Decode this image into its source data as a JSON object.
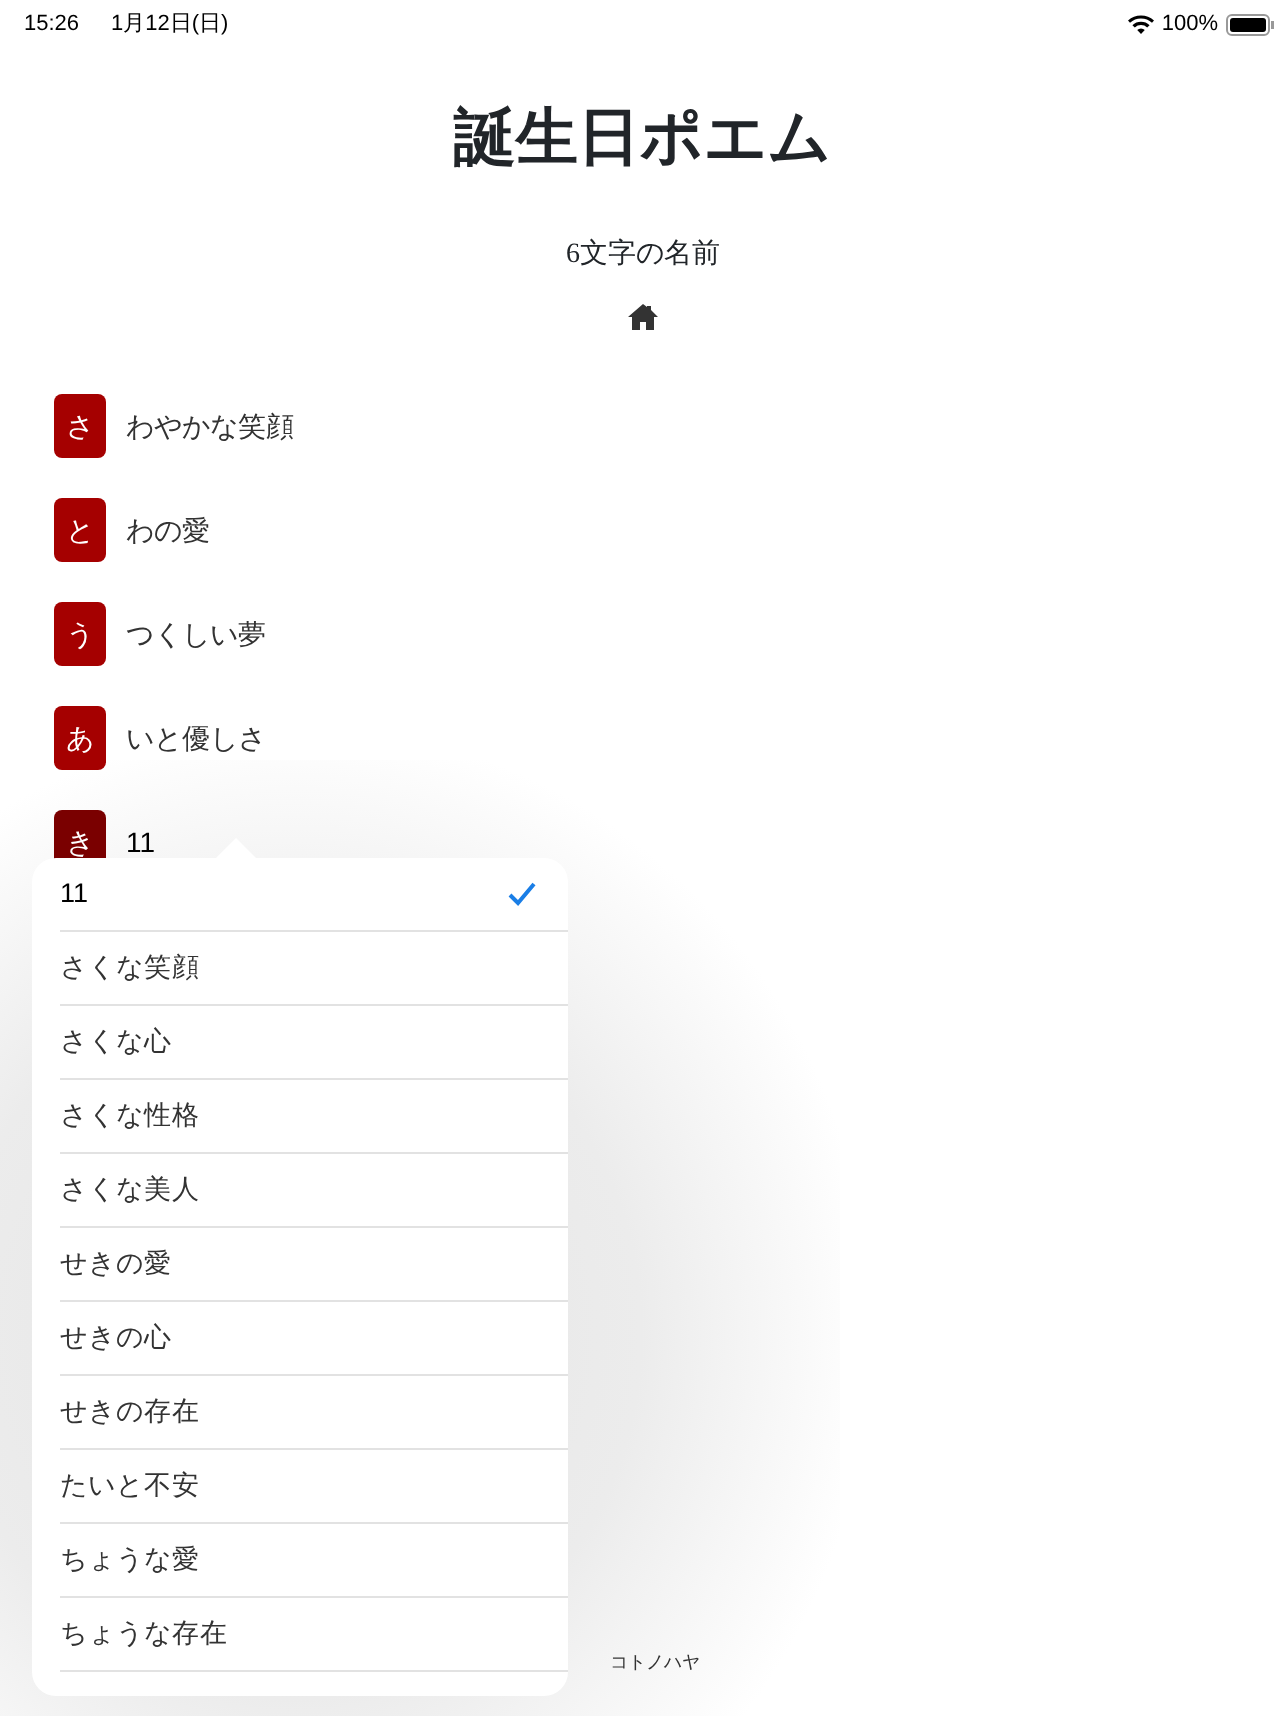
{
  "status_bar": {
    "time": "15:26",
    "date": "1月12日(日)",
    "battery": "100%"
  },
  "title": "誕生日ポエム",
  "subtitle": "6文字の名前",
  "rows": [
    {
      "letter": "さ",
      "text": "わやかな笑顔",
      "active": false
    },
    {
      "letter": "と",
      "text": "わの愛",
      "active": false
    },
    {
      "letter": "う",
      "text": "つくしい夢",
      "active": false
    },
    {
      "letter": "あ",
      "text": "いと優しさ",
      "active": false
    },
    {
      "letter": "き",
      "text": "11",
      "active": true
    }
  ],
  "popover": {
    "options": [
      {
        "label": "11",
        "selected": true
      },
      {
        "label": "さくな笑顔",
        "selected": false
      },
      {
        "label": "さくな心",
        "selected": false
      },
      {
        "label": "さくな性格",
        "selected": false
      },
      {
        "label": "さくな美人",
        "selected": false
      },
      {
        "label": "せきの愛",
        "selected": false
      },
      {
        "label": "せきの心",
        "selected": false
      },
      {
        "label": "せきの存在",
        "selected": false
      },
      {
        "label": "たいと不安",
        "selected": false
      },
      {
        "label": "ちょうな愛",
        "selected": false
      },
      {
        "label": "ちょうな存在",
        "selected": false
      }
    ]
  },
  "footer": "コトノハヤ"
}
